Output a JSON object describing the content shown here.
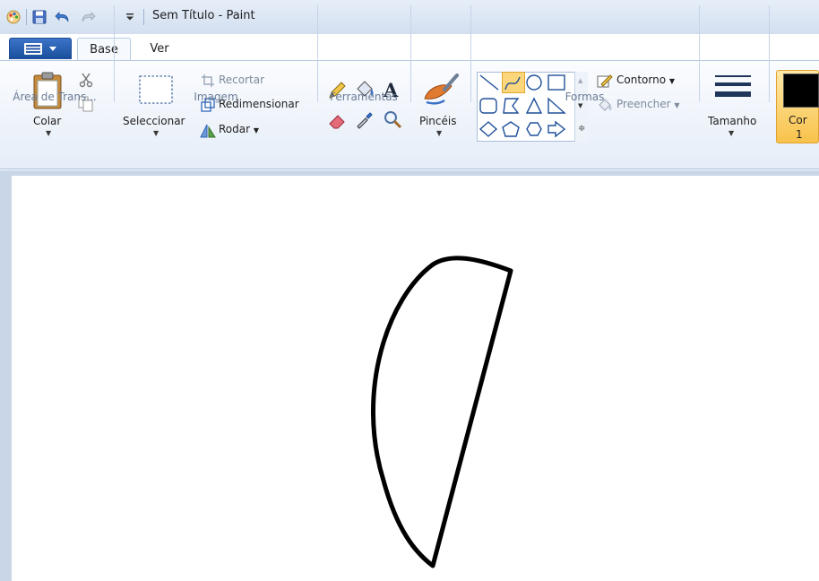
{
  "window": {
    "title": "Sem Título - Paint"
  },
  "tabs": [
    {
      "label": "Base"
    },
    {
      "label": "Ver"
    }
  ],
  "ribbon": {
    "clipboard": {
      "group_label": "Área de Trans...",
      "paste_label": "Colar"
    },
    "image": {
      "group_label": "Imagem",
      "select_label": "Seleccionar",
      "crop_label": "Recortar",
      "resize_label": "Redimensionar",
      "rotate_label": "Rodar"
    },
    "tools": {
      "group_label": "Ferramentas",
      "brushes_label": "Pincéis",
      "text_tool_glyph": "A"
    },
    "shapes": {
      "group_label": "Formas",
      "outline_label": "Contorno",
      "fill_label": "Preencher",
      "selected_shape": "curve"
    },
    "size": {
      "label": "Tamanho"
    },
    "colors": {
      "color1_label": "Cor",
      "color1_number": "1",
      "color1_value": "#000000"
    }
  },
  "theme": {
    "selection_accent": "#f8c24b",
    "ribbon_text": "#1e1e1e"
  }
}
